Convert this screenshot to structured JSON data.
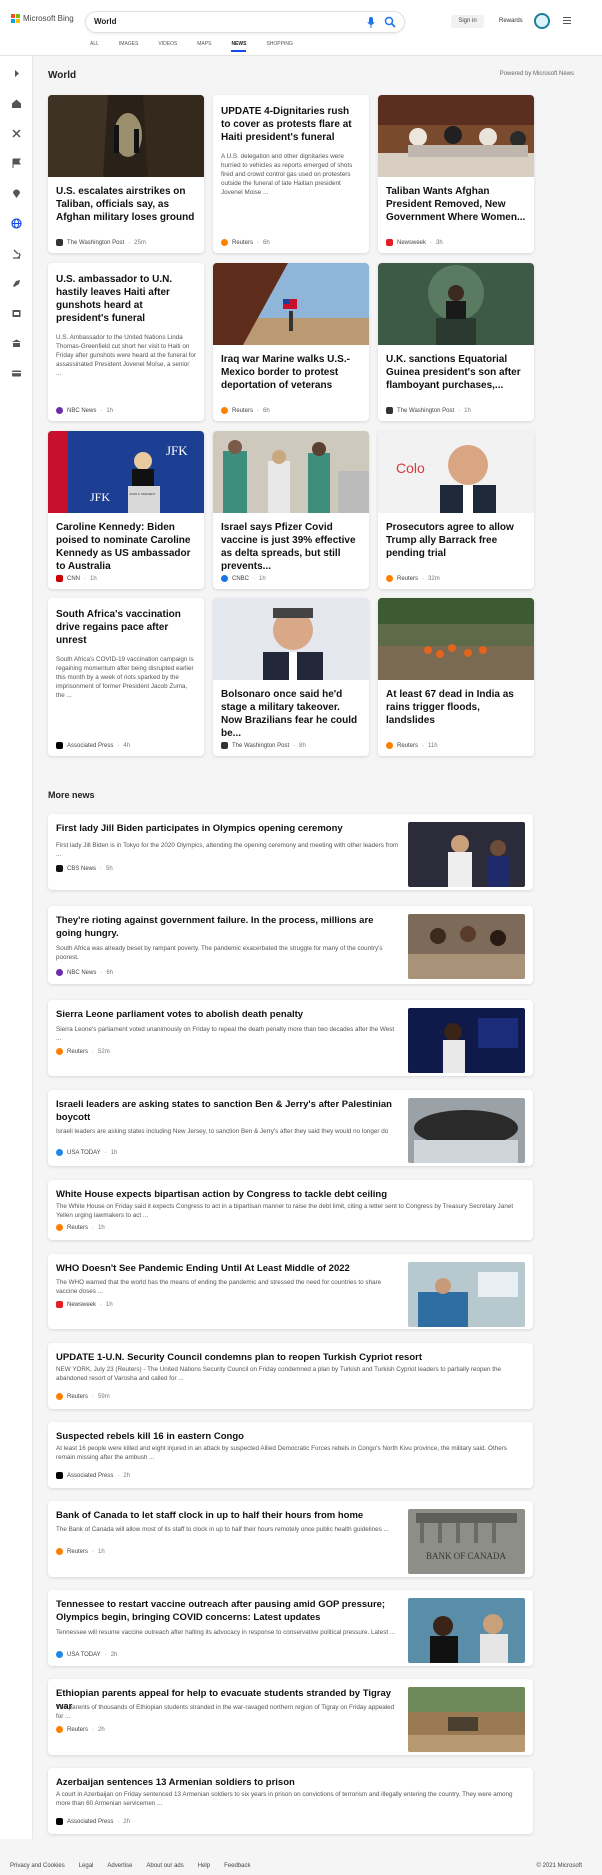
{
  "brand": {
    "name": "Microsoft Bing",
    "logo_colors": [
      "#f25022",
      "#7fba00",
      "#00a4ef",
      "#ffb900"
    ]
  },
  "search": {
    "query": "World"
  },
  "tabs": [
    {
      "label": "ALL"
    },
    {
      "label": "IMAGES"
    },
    {
      "label": "VIDEOS"
    },
    {
      "label": "MAPS"
    },
    {
      "label": "NEWS",
      "active": true
    },
    {
      "label": "SHOPPING"
    }
  ],
  "header": {
    "sign_in": "Sign in",
    "rewards": "Rewards"
  },
  "rail_icons": [
    "chevron-right-icon",
    "home-icon",
    "pinwheel-icon",
    "flag-icon",
    "location-pin-icon",
    "globe-icon",
    "microscope-icon",
    "rocket-icon",
    "film-icon",
    "building-icon",
    "card-icon"
  ],
  "section": {
    "title": "World",
    "powered": "Powered by Microsoft News"
  },
  "cards": [
    {
      "title": "U.S. escalates airstrikes on Taliban, officials say, as Afghan military loses ground",
      "source": "The Washington Post",
      "age": "25m",
      "has_image": true
    },
    {
      "title": "UPDATE 4-Dignitaries rush to cover as protests flare at Haiti president's funeral",
      "snippet": "A U.S. delegation and other dignitaries were hurried to vehicles as reports emerged of shots fired and crowd control gas used on protesters outside the funeral of late Haitian president Jovenel Moise ...",
      "source": "Reuters",
      "age": "6h",
      "has_image": false
    },
    {
      "title": "Taliban Wants Afghan President Removed, New Government Where Women...",
      "source": "Newsweek",
      "age": "3h",
      "has_image": true
    },
    {
      "title": "U.S. ambassador to U.N. hastily leaves Haiti after gunshots heard at president's funeral",
      "snippet": "U.S. Ambassador to the United Nations Linda Thomas-Greenfield cut short her visit to Haiti on Friday after gunshots were heard at the funeral for assassinated President Jovenel Moïse, a senior ...",
      "source": "NBC News",
      "age": "1h",
      "has_image": false
    },
    {
      "title": "Iraq war Marine walks U.S.-Mexico border to protest deportation of veterans",
      "source": "Reuters",
      "age": "6h",
      "has_image": true
    },
    {
      "title": "U.K. sanctions Equatorial Guinea president's son after flamboyant purchases,...",
      "source": "The Washington Post",
      "age": "1h",
      "has_image": true
    },
    {
      "title": "Caroline Kennedy: Biden poised to nominate Caroline Kennedy as US ambassador to Australia",
      "source": "CNN",
      "age": "1h",
      "has_image": true
    },
    {
      "title": "Israel says Pfizer Covid vaccine is just 39% effective as delta spreads, but still prevents...",
      "source": "CNBC",
      "age": "1h",
      "has_image": true
    },
    {
      "title": "Prosecutors agree to allow Trump ally Barrack free pending trial",
      "source": "Reuters",
      "age": "32m",
      "has_image": true
    },
    {
      "title": "South Africa's vaccination drive regains pace after unrest",
      "snippet": "South Africa's COVID-19 vaccination campaign is regaining momentum after being disrupted earlier this month by a week of riots sparked by the imprisonment of former President Jacob Zuma, the ...",
      "source": "Associated Press",
      "age": "4h",
      "has_image": false
    },
    {
      "title": "Bolsonaro once said he'd stage a military takeover. Now Brazilians fear he could be...",
      "source": "The Washington Post",
      "age": "8h",
      "has_image": true
    },
    {
      "title": "At least 67 dead in India as rains trigger floods, landslides",
      "source": "Reuters",
      "age": "11h",
      "has_image": true
    }
  ],
  "more": {
    "title": "More news",
    "items": [
      {
        "title": "First lady Jill Biden participates in Olympics opening ceremony",
        "snippet": "First lady Jill Biden is in Tokyo for the 2020 Olympics, attending the opening ceremony and meeting with other leaders from ...",
        "source": "CBS News",
        "age": "5h",
        "has_image": true
      },
      {
        "title": "They're rioting against government failure. In the process, millions are going hungry.",
        "snippet": "South Africa was already beset by rampant poverty. The pandemic exacerbated the struggle for many of the country's poorest.",
        "source": "NBC News",
        "age": "6h",
        "has_image": true
      },
      {
        "title": "Sierra Leone parliament votes to abolish death penalty",
        "snippet": "Sierra Leone's parliament voted unanimously on Friday to repeal the death penalty more than two decades after the West ...",
        "source": "Reuters",
        "age": "52m",
        "has_image": true
      },
      {
        "title": "Israeli leaders are asking states to sanction Ben & Jerry's after Palestinian boycott",
        "snippet": "Israeli leaders are asking states including New Jersey, to sanction Ben & Jerry's after they said they would no longer do",
        "source": "USA TODAY",
        "age": "1h",
        "has_image": true
      },
      {
        "title": "White House expects bipartisan action by Congress to tackle debt ceiling",
        "snippet": "The White House on Friday said it expects Congress to act in a bipartisan manner to raise the debt limit, citing a letter sent to Congress by Treasury Secretary Janet Yellen urging lawmakers to act ...",
        "source": "Reuters",
        "age": "1h",
        "has_image": false
      },
      {
        "title": "WHO Doesn't See Pandemic Ending Until At Least Middle of 2022",
        "snippet": "The WHO warned that the world has the means of ending the pandemic and stressed the need for countries to share vaccine doses ...",
        "source": "Newsweek",
        "age": "1h",
        "has_image": true
      },
      {
        "title": "UPDATE 1-U.N. Security Council condemns plan to reopen Turkish Cypriot resort",
        "snippet": "NEW YORK, July 23 (Reuters) - The United Nations Security Council on Friday condemned a plan by Turkish and Turkish Cypriot leaders to partially reopen the abandoned resort of Varosha and called for ...",
        "source": "Reuters",
        "age": "59m",
        "has_image": false
      },
      {
        "title": "Suspected rebels kill 16 in eastern Congo",
        "snippet": "At least 16 people were killed and eight injured in an attack by suspected Allied Democratic Forces rebels in Congo's North Kivu province, the military said. Others remain missing after the ambush ...",
        "source": "Associated Press",
        "age": "2h",
        "has_image": false
      },
      {
        "title": "Bank of Canada to let staff clock in up to half their hours from home",
        "snippet": "The Bank of Canada will allow most of its staff to clock in up to half their hours remotely once public health guidelines ...",
        "source": "Reuters",
        "age": "1h",
        "has_image": true
      },
      {
        "title": "Tennessee to restart vaccine outreach after pausing amid GOP pressure; Olympics begin, bringing COVID concerns: Latest updates",
        "snippet": "Tennessee will resume vaccine outreach after halting its advocacy in response to conservative political pressure. Latest ...",
        "source": "USA TODAY",
        "age": "2h",
        "has_image": true
      },
      {
        "title": "Ethiopian parents appeal for help to evacuate students stranded by Tigray war",
        "snippet": "The parents of thousands of Ethiopian students stranded in the war-ravaged northern region of Tigray on Friday appealed for ...",
        "source": "Reuters",
        "age": "2h",
        "has_image": true
      },
      {
        "title": "Azerbaijan sentences 13 Armenian soldiers to prison",
        "snippet": "A court in Azerbaijan on Friday sentenced 13 Armenian soldiers to six years in prison on convictions of terrorism and illegally entering the country. They were among more than 60 Armenian servicemen ...",
        "source": "Associated Press",
        "age": "2h",
        "has_image": false
      }
    ]
  },
  "image_texts": {
    "kennedy_banner": "JFK",
    "kennedy_podium": "JOHN F. KENNEDY",
    "bank_sign": "BANK OF CANADA",
    "trump_ally_bg": "Colo"
  },
  "footer": {
    "links": [
      "Privacy and Cookies",
      "Legal",
      "Advertise",
      "About our ads",
      "Help",
      "Feedback"
    ],
    "copyright": "© 2021 Microsoft"
  },
  "colors": {
    "accent": "#174ae4",
    "reuters": "#ff8000",
    "newsweek": "#e31e24",
    "cnn": "#cc0000"
  }
}
